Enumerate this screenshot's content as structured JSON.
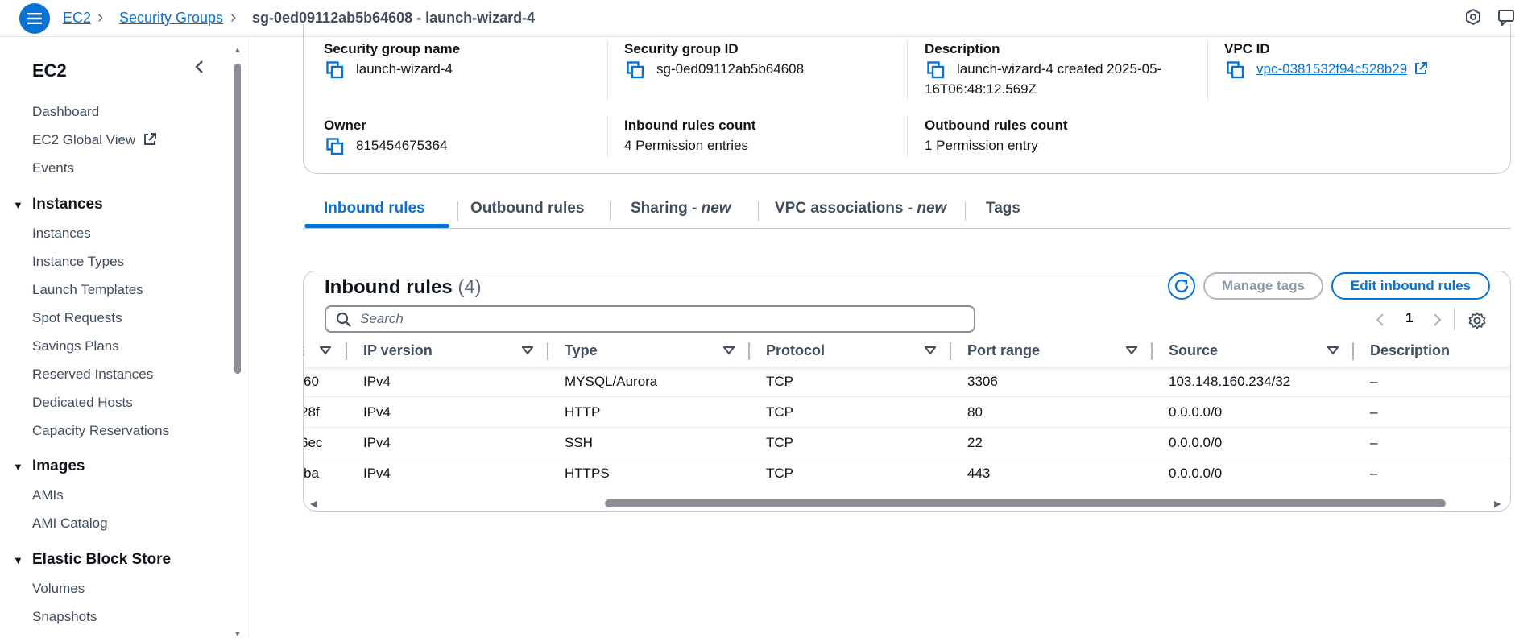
{
  "header": {
    "breadcrumbs": [
      "EC2",
      "Security Groups"
    ],
    "current": "sg-0ed09112ab5b64608 - launch-wizard-4"
  },
  "sidebar": {
    "title": "EC2",
    "top_items": [
      "Dashboard",
      "EC2 Global View",
      "Events"
    ],
    "sections": [
      {
        "label": "Instances",
        "items": [
          "Instances",
          "Instance Types",
          "Launch Templates",
          "Spot Requests",
          "Savings Plans",
          "Reserved Instances",
          "Dedicated Hosts",
          "Capacity Reservations"
        ]
      },
      {
        "label": "Images",
        "items": [
          "AMIs",
          "AMI Catalog"
        ]
      },
      {
        "label": "Elastic Block Store",
        "items": [
          "Volumes",
          "Snapshots"
        ]
      }
    ]
  },
  "details": {
    "sg_name_label": "Security group name",
    "sg_name": "launch-wizard-4",
    "sg_id_label": "Security group ID",
    "sg_id": "sg-0ed09112ab5b64608",
    "desc_label": "Description",
    "desc_line1": "launch-wizard-4 created 2025-05-",
    "desc_line2": "16T06:48:12.569Z",
    "vpc_label": "VPC ID",
    "vpc_id": "vpc-0381532f94c528b29",
    "owner_label": "Owner",
    "owner": "815454675364",
    "inbound_count_label": "Inbound rules count",
    "inbound_count": "4 Permission entries",
    "outbound_count_label": "Outbound rules count",
    "outbound_count": "1 Permission entry"
  },
  "tabs": [
    {
      "label": "Inbound rules"
    },
    {
      "label": "Outbound rules"
    },
    {
      "label": "Sharing - ",
      "new": "new"
    },
    {
      "label": "VPC associations - ",
      "new": "new"
    },
    {
      "label": "Tags"
    }
  ],
  "rules_panel": {
    "title": "Inbound rules",
    "count": "(4)",
    "manage_tags": "Manage tags",
    "edit_rules": "Edit inbound rules",
    "search_placeholder": "Search",
    "page": "1",
    "columns": [
      "IP version",
      "Type",
      "Protocol",
      "Port range",
      "Source",
      "Description"
    ],
    "rows": [
      {
        "id_tail": "60",
        "ip": "IPv4",
        "type": "MYSQL/Aurora",
        "protocol": "TCP",
        "port": "3306",
        "source": "103.148.160.234/32",
        "desc": "–"
      },
      {
        "id_tail": "28f",
        "ip": "IPv4",
        "type": "HTTP",
        "protocol": "TCP",
        "port": "80",
        "source": "0.0.0.0/0",
        "desc": "–"
      },
      {
        "id_tail": "6ec",
        "ip": "IPv4",
        "type": "SSH",
        "protocol": "TCP",
        "port": "22",
        "source": "0.0.0.0/0",
        "desc": "–"
      },
      {
        "id_tail": "ba",
        "ip": "IPv4",
        "type": "HTTPS",
        "protocol": "TCP",
        "port": "443",
        "source": "0.0.0.0/0",
        "desc": "–"
      }
    ]
  },
  "colors": {
    "accent": "#0972d3",
    "text": "#0f141a",
    "muted": "#5f6b7a",
    "border": "#c6c6cd"
  }
}
